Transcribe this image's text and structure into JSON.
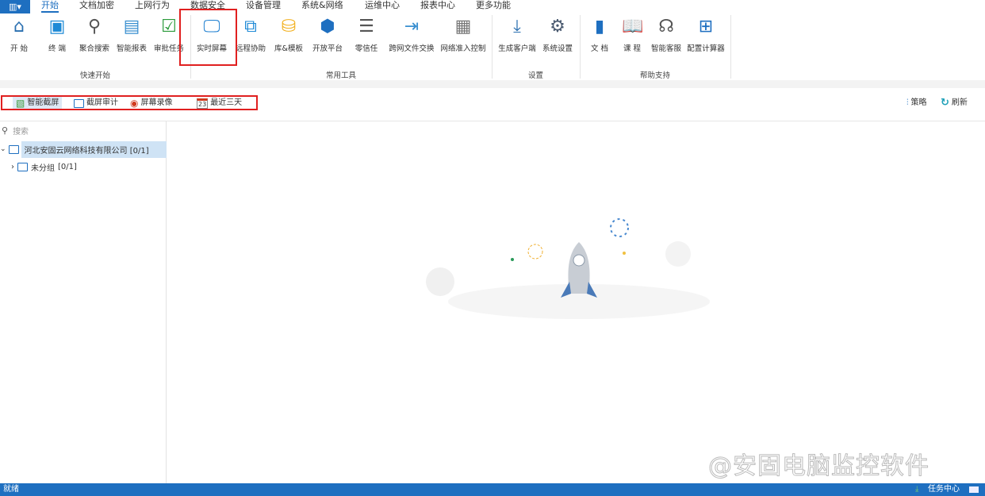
{
  "menu": {
    "app_icon": "app-menu-icon",
    "tabs": [
      "开始",
      "文档加密",
      "上网行为",
      "数据安全",
      "设备管理",
      "系统&网络",
      "运维中心",
      "报表中心",
      "更多功能"
    ],
    "active": "开始"
  },
  "ribbon": {
    "groups": [
      {
        "label": "快速开始"
      },
      {
        "label": "常用工具"
      },
      {
        "label": "设置"
      },
      {
        "label": "帮助支持"
      }
    ],
    "buttons": [
      "开 始",
      "终 端",
      "聚合搜索",
      "智能报表",
      "审批任务",
      "实时屏幕",
      "远程协助",
      "库&模板",
      "开放平台",
      "零信任",
      "跨网文件交换",
      "网络准入控制",
      "生成客户端",
      "系统设置",
      "文 档",
      "课 程",
      "智能客服",
      "配置计算器"
    ]
  },
  "toolbar": {
    "items": [
      "智能截屏",
      "截屏审计",
      "屏幕录像",
      "最近三天"
    ],
    "calendar_day": "23",
    "strategy": "策略",
    "refresh": "刷新"
  },
  "sidebar": {
    "search_placeholder": "搜索",
    "tree": [
      {
        "label": "河北安固云网络科技有限公司",
        "count": "[0/1]"
      },
      {
        "label": "未分组",
        "count": "[0/1]"
      }
    ]
  },
  "watermark": "@安固电脑监控软件",
  "status": {
    "left": "就绪",
    "task_center": "任务中心"
  },
  "colors": {
    "accent": "#1e6fc0",
    "highlight": "#e02020"
  }
}
